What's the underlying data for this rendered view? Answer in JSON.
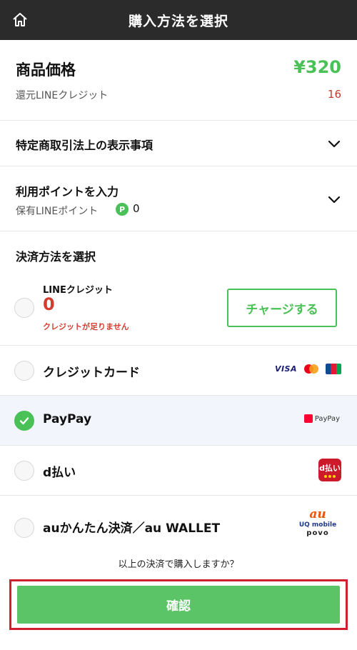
{
  "header": {
    "title": "購入方法を選択"
  },
  "price": {
    "label": "商品価格",
    "amount": "¥320",
    "credit_label": "還元LINEクレジット",
    "credit_value": "16"
  },
  "legal": {
    "label": "特定商取引法上の表示事項"
  },
  "points": {
    "label": "利用ポイントを入力",
    "held_label": "保有LINEポイント",
    "badge": "P",
    "value": "0"
  },
  "payment": {
    "title": "決済方法を選択",
    "line_credit": {
      "name": "LINEクレジット",
      "value": "0",
      "warning": "クレジットが足りません",
      "charge_label": "チャージする"
    },
    "options": [
      {
        "name": "クレジットカード",
        "selected": false
      },
      {
        "name": "PayPay",
        "selected": true
      },
      {
        "name": "d払い",
        "selected": false
      },
      {
        "name": "auかんたん決済／au WALLET",
        "selected": false
      }
    ],
    "logos": {
      "visa": "VISA",
      "paypay": "PayPay",
      "dpay": "d払い",
      "au": "au",
      "uq": "UQ mobile",
      "povo": "povo"
    }
  },
  "confirm": {
    "prompt": "以上の決済で購入しますか？",
    "button_label": "確認"
  },
  "colors": {
    "accent": "#49c157",
    "header_bg": "#2b2b2b",
    "error": "#d63b30",
    "highlight_border": "#d02030"
  }
}
